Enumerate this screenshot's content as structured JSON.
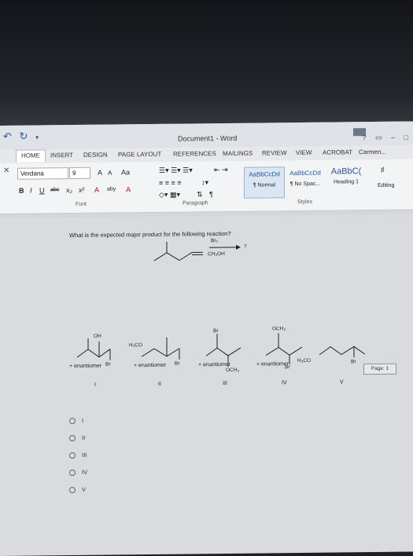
{
  "window": {
    "title": "Document1 - Word",
    "controls": [
      "?",
      "▭",
      "–",
      "□"
    ]
  },
  "quick_access": [
    "undo-icon",
    "redo-icon",
    "customize-icon"
  ],
  "tabs": [
    {
      "label": "HOME",
      "active": true
    },
    {
      "label": "INSERT"
    },
    {
      "label": "DESIGN"
    },
    {
      "label": "PAGE LAYOUT"
    },
    {
      "label": "REFERENCES"
    },
    {
      "label": "MAILINGS"
    },
    {
      "label": "REVIEW"
    },
    {
      "label": "VIEW"
    },
    {
      "label": "ACROBAT"
    },
    {
      "label": "Carmen..."
    }
  ],
  "ribbon": {
    "font_name": "Verdana",
    "font_size": "9",
    "grow_font": "A",
    "shrink_font": "A",
    "change_case": "Aa",
    "bold": "B",
    "italic": "I",
    "underline": "U",
    "strike": "abc",
    "subscript": "x₂",
    "superscript": "x²",
    "font_color": "A",
    "highlight": "aby",
    "font_group": "Font",
    "paragraph_group": "Paragraph",
    "styles_group": "Styles",
    "editing": "Editing",
    "styles": [
      {
        "sample": "AaBbCcDd",
        "name": "¶ Normal",
        "selected": true
      },
      {
        "sample": "AaBbCcDd",
        "name": "¶ No Spac..."
      },
      {
        "sample": "AaBbC(",
        "name": "Heading 1"
      }
    ]
  },
  "document": {
    "question": "What is the expected major product for the following reaction?",
    "reagent_top": "Br₂",
    "reagent_bottom": "CH₃OH",
    "question_mark": "?",
    "structure_labels": {
      "oh": "OH",
      "br1": "Br",
      "h3co": "H₃CO",
      "br2": "Br",
      "br3": "Br",
      "och3_a": "OCH₃",
      "och3_b": "OCH₃",
      "br4": "Br",
      "h3co_b": "H₃CO",
      "br5": "Br"
    },
    "enantiomer_notes": [
      "+ enantiomer",
      "+ enantiomer",
      "+ enantiomer",
      "+ enantiomer"
    ],
    "numerals": [
      "I",
      "II",
      "III",
      "IV",
      "V"
    ],
    "page_indicator": "Page: 1"
  },
  "answer_options": [
    "I",
    "II",
    "III",
    "IV",
    "V"
  ]
}
